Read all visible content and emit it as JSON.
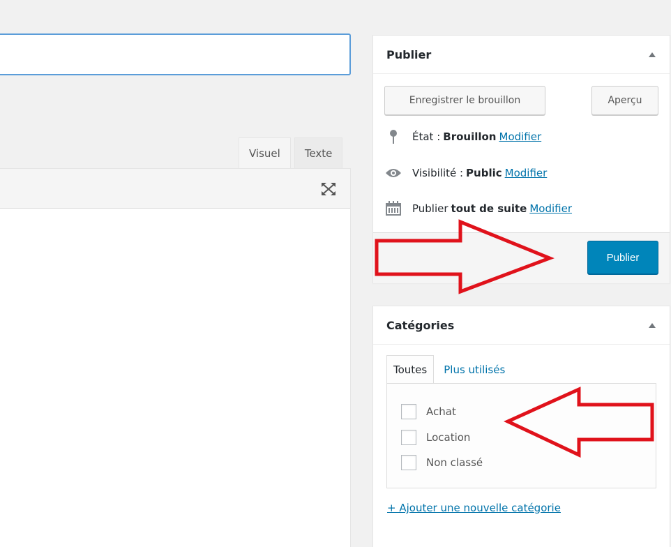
{
  "editor": {
    "title_value": "",
    "tabs": [
      {
        "label": "Visuel",
        "active": true
      },
      {
        "label": "Texte",
        "active": false
      }
    ]
  },
  "publish_box": {
    "title": "Publier",
    "save_draft_label": "Enregistrer le brouillon",
    "preview_label": "Aperçu",
    "status": {
      "prefix": "État :",
      "value": "Brouillon",
      "edit_label": "Modifier"
    },
    "visibility": {
      "prefix": "Visibilité :",
      "value": "Public",
      "edit_label": "Modifier"
    },
    "schedule": {
      "prefix": "Publier",
      "value": "tout de suite",
      "edit_label": "Modifier"
    },
    "publish_label": "Publier"
  },
  "categories_box": {
    "title": "Catégories",
    "tabs": [
      {
        "label": "Toutes",
        "active": true
      },
      {
        "label": "Plus utilisés",
        "active": false
      }
    ],
    "items": [
      {
        "label": "Achat",
        "checked": false
      },
      {
        "label": "Location",
        "checked": false
      },
      {
        "label": "Non classé",
        "checked": false
      }
    ],
    "add_new_label": "+ Ajouter une nouvelle catégorie"
  },
  "colors": {
    "primary_button": "#0085ba",
    "link": "#0073aa",
    "annotation_arrow": "#e0121b"
  }
}
